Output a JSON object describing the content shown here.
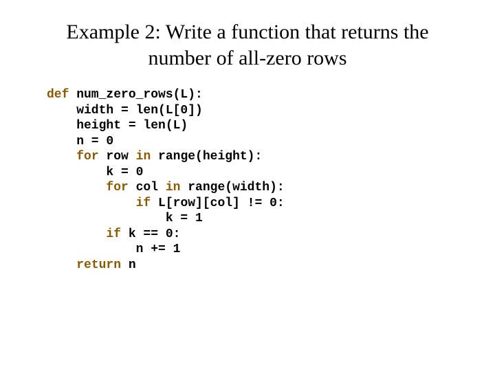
{
  "title_line1": "Example 2: Write a function that returns the",
  "title_line2": "number of all-zero rows",
  "code": {
    "l01_kw": "def",
    "l01_t": " num_zero_rows(L):",
    "l02": "    width = len(L[0])",
    "l03": "    height = len(L)",
    "l04": "    n = 0",
    "l05_i": "    ",
    "l05_kw": "for",
    "l05_t1": " row ",
    "l05_kw2": "in",
    "l05_t2": " range(height):",
    "l06": "        k = 0",
    "l07_i": "        ",
    "l07_kw": "for",
    "l07_t1": " col ",
    "l07_kw2": "in",
    "l07_t2": " range(width):",
    "l08_i": "            ",
    "l08_kw": "if",
    "l08_t": " L[row][col] != 0:",
    "l09": "                k = 1",
    "l10_i": "        ",
    "l10_kw": "if",
    "l10_t": " k == 0:",
    "l11": "            n += 1",
    "l12_i": "    ",
    "l12_kw": "return",
    "l12_t": " n"
  }
}
